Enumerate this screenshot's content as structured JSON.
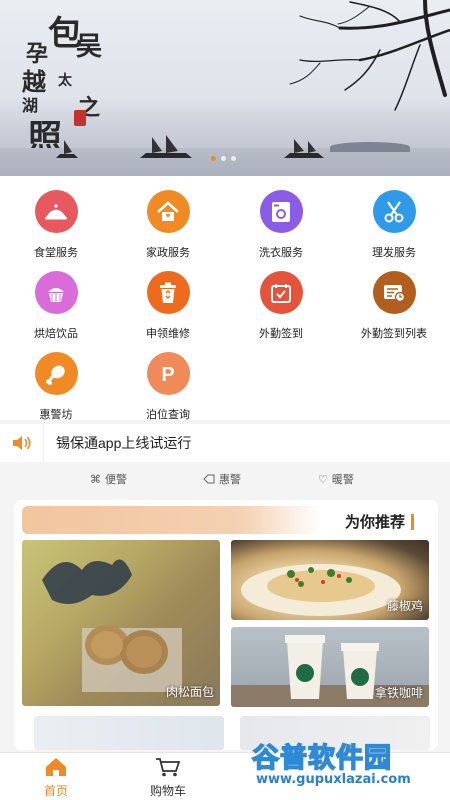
{
  "banner": {
    "calligraphy": [
      "包",
      "孕",
      "吴",
      "越",
      "太",
      "湖",
      "之",
      "照"
    ],
    "slides": 3,
    "active_slide": 1
  },
  "services": [
    {
      "label": "食堂服务",
      "icon": "food-cloche-icon",
      "color": "#e8585f"
    },
    {
      "label": "家政服务",
      "icon": "house-icon",
      "color": "#f08a24"
    },
    {
      "label": "洗衣服务",
      "icon": "washing-machine-icon",
      "color": "#8b5ce6"
    },
    {
      "label": "理发服务",
      "icon": "scissors-icon",
      "color": "#2f9be8"
    },
    {
      "label": "烘焙饮品",
      "icon": "cake-icon",
      "color": "#d96cd8"
    },
    {
      "label": "申领维修",
      "icon": "recycle-bin-icon",
      "color": "#ee6a1d"
    },
    {
      "label": "外勤签到",
      "icon": "calendar-check-icon",
      "color": "#e6533b"
    },
    {
      "label": "外勤签到列表",
      "icon": "list-card-icon",
      "color": "#b25f1e"
    },
    {
      "label": "惠警坊",
      "icon": "chicken-leg-icon",
      "color": "#f08a24"
    },
    {
      "label": "泊位查询",
      "icon": "parking-icon",
      "color": "#f08a58"
    }
  ],
  "notice": {
    "text": "锡保通app上线试运行",
    "icon": "speaker-icon"
  },
  "tabs": [
    {
      "label": "便警",
      "icon": "command-icon"
    },
    {
      "label": "惠警",
      "icon": "tag-icon"
    },
    {
      "label": "暖警",
      "icon": "heart-icon"
    }
  ],
  "recommend": {
    "title": "为你推荐",
    "items": [
      {
        "caption": "肉松面包"
      },
      {
        "caption": "藤椒鸡"
      },
      {
        "caption": "拿铁咖啡"
      }
    ]
  },
  "nav": [
    {
      "label": "首页",
      "icon": "home-icon",
      "active": true
    },
    {
      "label": "购物车",
      "icon": "cart-icon",
      "active": false
    }
  ],
  "watermark": {
    "name": "谷普软件园",
    "url": "www.gupuxlazai.com"
  },
  "colors": {
    "accent": "#f08a24"
  }
}
